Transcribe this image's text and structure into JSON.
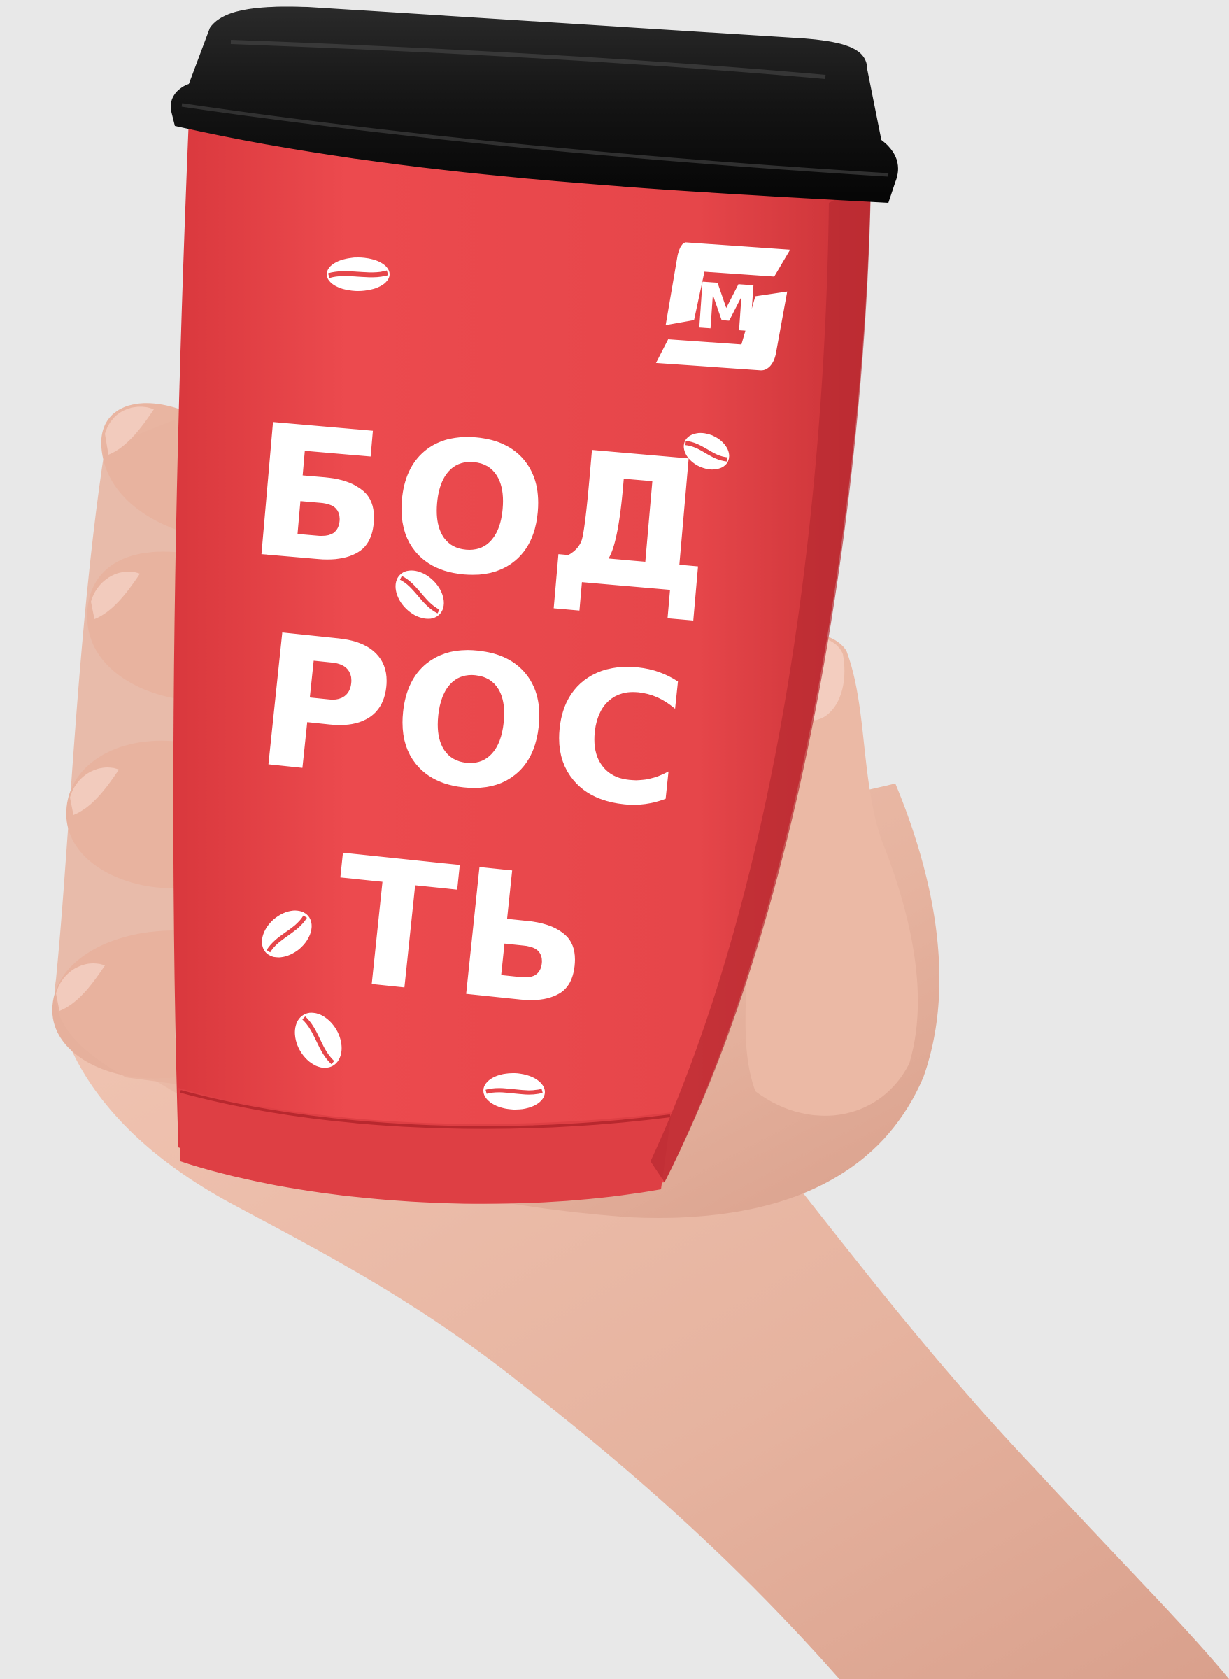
{
  "photo": {
    "cup_lettering": [
      "БОД",
      "РОС",
      "ТЬ"
    ],
    "logo_letter": "М",
    "colors": {
      "background": "#e8e8e8",
      "cup_red": "#e8464a",
      "lid_black": "#1a1a1a",
      "skin": "#e9b8a4",
      "print_white": "#ffffff"
    }
  }
}
